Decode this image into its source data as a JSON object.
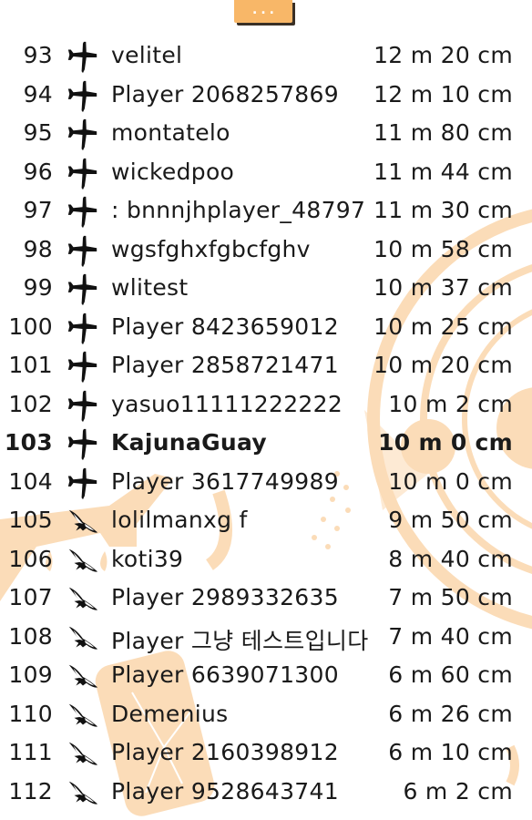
{
  "menu": {
    "label": "...",
    "icon": "more-dots-icon"
  },
  "colors": {
    "accent": "#f8b768",
    "background_art": "#fbdcb8",
    "text": "#1a1a1a"
  },
  "rows": [
    {
      "rank": "93",
      "icon": "airplane-icon",
      "name": "velitel",
      "distance": "12 m 20 cm",
      "highlight": false
    },
    {
      "rank": "94",
      "icon": "airplane-icon",
      "name": "Player 2068257869",
      "distance": "12 m 10 cm",
      "highlight": false
    },
    {
      "rank": "95",
      "icon": "airplane-icon",
      "name": "montatelo",
      "distance": "11 m 80 cm",
      "highlight": false
    },
    {
      "rank": "96",
      "icon": "airplane-icon",
      "name": "wickedpoo",
      "distance": "11 m 44 cm",
      "highlight": false
    },
    {
      "rank": "97",
      "icon": "airplane-icon",
      "name": ": bnnnjhplayer_48797",
      "distance": "11 m 30 cm",
      "highlight": false
    },
    {
      "rank": "98",
      "icon": "airplane-icon",
      "name": "wgsfghxfgbcfghv",
      "distance": "10 m 58 cm",
      "highlight": false
    },
    {
      "rank": "99",
      "icon": "airplane-icon",
      "name": "wlitest",
      "distance": "10 m 37 cm",
      "highlight": false
    },
    {
      "rank": "100",
      "icon": "airplane-icon",
      "name": "Player 8423659012",
      "distance": "10 m 25 cm",
      "highlight": false
    },
    {
      "rank": "101",
      "icon": "airplane-icon",
      "name": "Player 2858721471",
      "distance": "10 m 20 cm",
      "highlight": false
    },
    {
      "rank": "102",
      "icon": "airplane-icon",
      "name": "yasuo11111222222",
      "distance": "10 m 2 cm",
      "highlight": false
    },
    {
      "rank": "103",
      "icon": "airplane-icon",
      "name": "KajunaGuay",
      "distance": "10 m 0 cm",
      "highlight": true
    },
    {
      "rank": "104",
      "icon": "airplane-icon",
      "name": "Player 3617749989",
      "distance": "10 m 0 cm",
      "highlight": false
    },
    {
      "rank": "105",
      "icon": "bird-icon",
      "name": "lolilmanxg f",
      "distance": "9 m 50 cm",
      "highlight": false
    },
    {
      "rank": "106",
      "icon": "bird-icon",
      "name": "koti39",
      "distance": "8 m 40 cm",
      "highlight": false
    },
    {
      "rank": "107",
      "icon": "bird-icon",
      "name": "Player 2989332635",
      "distance": "7 m 50 cm",
      "highlight": false
    },
    {
      "rank": "108",
      "icon": "bird-icon",
      "name": "Player 그냥 테스트입니다",
      "distance": "7 m 40 cm",
      "highlight": false
    },
    {
      "rank": "109",
      "icon": "bird-icon",
      "name": "Player 6639071300",
      "distance": "6 m 60 cm",
      "highlight": false
    },
    {
      "rank": "110",
      "icon": "bird-icon",
      "name": "Demenius",
      "distance": "6 m 26 cm",
      "highlight": false
    },
    {
      "rank": "111",
      "icon": "bird-icon",
      "name": "Player 2160398912",
      "distance": "6 m 10 cm",
      "highlight": false
    },
    {
      "rank": "112",
      "icon": "bird-icon",
      "name": "Player 9528643741",
      "distance": "6 m 2 cm",
      "highlight": false
    }
  ]
}
